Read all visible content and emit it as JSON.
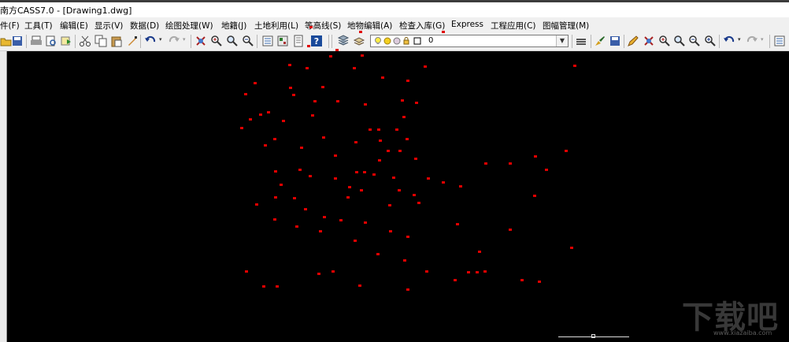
{
  "window": {
    "title": "南方CASS7.0 - [Drawing1.dwg]"
  },
  "menu": [
    {
      "id": "file",
      "label": "件(F)"
    },
    {
      "id": "tools",
      "label": "工具(T)"
    },
    {
      "id": "edit",
      "label": "编辑(E)"
    },
    {
      "id": "view",
      "label": "显示(V)"
    },
    {
      "id": "data",
      "label": "数据(D)"
    },
    {
      "id": "draw",
      "label": "绘图处理(W)"
    },
    {
      "id": "cadastre",
      "label": "地籍(J)"
    },
    {
      "id": "landuse",
      "label": "土地利用(L)"
    },
    {
      "id": "contour",
      "label": "等高线(S)"
    },
    {
      "id": "feature",
      "label": "地物编辑(A)"
    },
    {
      "id": "check",
      "label": "检查入库(G)"
    },
    {
      "id": "express",
      "label": "Express"
    },
    {
      "id": "engineering",
      "label": "工程应用(C)"
    },
    {
      "id": "sheet",
      "label": "图幅管理(M)"
    }
  ],
  "toolbar": {
    "layer_name": "0",
    "icons": [
      "open-icon",
      "save-icon",
      "print-icon",
      "print-preview-icon",
      "publish-icon",
      "cut-icon",
      "copy-icon",
      "paste-icon",
      "match-properties-icon",
      "undo-icon",
      "redo-icon",
      "pan-icon",
      "zoom-realtime-icon",
      "zoom-window-icon",
      "zoom-previous-icon",
      "properties-icon",
      "design-center-icon",
      "tool-palette-icon",
      "help-icon",
      "layer-manager-icon",
      "layer-previous-icon",
      "linetype-icon",
      "brush-icon",
      "save-as-icon",
      "pencil-icon",
      "pan-icon-2",
      "zoom-extents-icon",
      "zoom-in-icon",
      "zoom-out-icon",
      "zoom-all-icon",
      "undo-icon-2",
      "redo-icon-2",
      "properties-icon-2"
    ]
  },
  "watermark": {
    "text": "下载吧",
    "url": "www.xiazaiba.com"
  },
  "colors": {
    "canvas": "#000000",
    "points": "#e00000",
    "chrome": "#f0f0f0"
  }
}
